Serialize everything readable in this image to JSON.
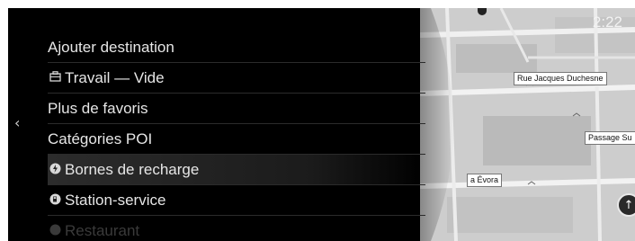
{
  "status": {
    "clock": "2:22"
  },
  "menu": {
    "items": [
      {
        "label": "Ajouter destination",
        "icon": ""
      },
      {
        "label": "Travail — Vide",
        "icon": "briefcase-icon"
      },
      {
        "label": "Plus de favoris",
        "icon": ""
      },
      {
        "label": "Catégories POI",
        "icon": ""
      },
      {
        "label": "Bornes de recharge",
        "icon": "charging-station-icon"
      },
      {
        "label": "Station-service",
        "icon": "fuel-station-icon"
      },
      {
        "label": "Restaurant",
        "icon": "restaurant-icon"
      }
    ],
    "selected_index": 4
  },
  "map": {
    "streets": [
      "Rue Jacques Duchesne",
      "Passage Su",
      "a Évora"
    ]
  }
}
